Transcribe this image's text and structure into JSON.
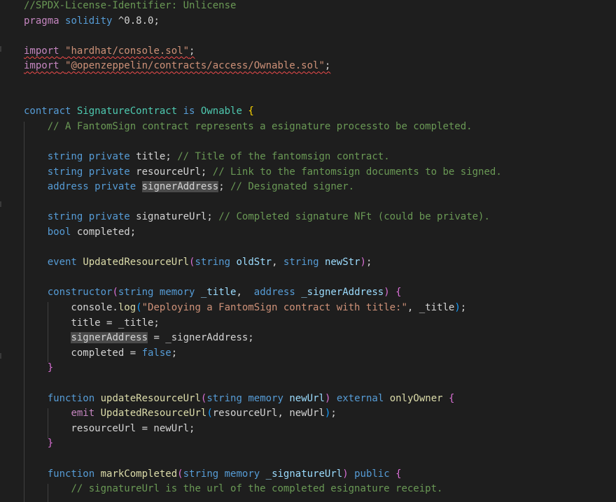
{
  "editor": {
    "lines": [
      [
        {
          "t": "//SPDX-License-Identifier: Unlicense",
          "c": "#6a9955"
        }
      ],
      [
        {
          "t": "pragma",
          "c": "#c586c0"
        },
        {
          "t": " "
        },
        {
          "t": "solidity",
          "c": "#569cd6"
        },
        {
          "t": " ^0.8.0;"
        }
      ],
      [],
      [
        {
          "t": "import",
          "c": "#c586c0",
          "u": true
        },
        {
          "t": " ",
          "u": true
        },
        {
          "t": "\"hardhat/console.sol\"",
          "c": "#ce9178",
          "u": true
        },
        {
          "t": ";",
          "u": true
        }
      ],
      [
        {
          "t": "import",
          "c": "#c586c0",
          "u": true
        },
        {
          "t": " ",
          "u": true
        },
        {
          "t": "\"@openzeppelin/contracts/access/Ownable.sol\"",
          "c": "#ce9178",
          "u": true
        },
        {
          "t": ";",
          "u": true
        }
      ],
      [],
      [],
      [
        {
          "t": "contract",
          "c": "#569cd6"
        },
        {
          "t": " "
        },
        {
          "t": "SignatureContract",
          "c": "#4ec9b0"
        },
        {
          "t": " "
        },
        {
          "t": "is",
          "c": "#569cd6"
        },
        {
          "t": " "
        },
        {
          "t": "Ownable",
          "c": "#4ec9b0"
        },
        {
          "t": " "
        },
        {
          "t": "{",
          "c": "#ffd700"
        }
      ],
      [
        {
          "t": "    "
        },
        {
          "t": "// A FantomSign contract represents a esignature processto be completed.",
          "c": "#6a9955"
        }
      ],
      [],
      [
        {
          "t": "    "
        },
        {
          "t": "string",
          "c": "#569cd6"
        },
        {
          "t": " "
        },
        {
          "t": "private",
          "c": "#569cd6"
        },
        {
          "t": " title; "
        },
        {
          "t": "// Title of the fantomsign contract.",
          "c": "#6a9955"
        }
      ],
      [
        {
          "t": "    "
        },
        {
          "t": "string",
          "c": "#569cd6"
        },
        {
          "t": " "
        },
        {
          "t": "private",
          "c": "#569cd6"
        },
        {
          "t": " resourceUrl; "
        },
        {
          "t": "// Link to the fantomsign documents to be signed.",
          "c": "#6a9955"
        }
      ],
      [
        {
          "t": "    "
        },
        {
          "t": "address",
          "c": "#569cd6"
        },
        {
          "t": " "
        },
        {
          "t": "private",
          "c": "#569cd6"
        },
        {
          "t": " "
        },
        {
          "t": "signerAddress",
          "h": true
        },
        {
          "t": "; "
        },
        {
          "t": "// Designated signer.",
          "c": "#6a9955"
        }
      ],
      [],
      [
        {
          "t": "    "
        },
        {
          "t": "string",
          "c": "#569cd6"
        },
        {
          "t": " "
        },
        {
          "t": "private",
          "c": "#569cd6"
        },
        {
          "t": " signatureUrl; "
        },
        {
          "t": "// Completed signature NFt (could be private).",
          "c": "#6a9955"
        }
      ],
      [
        {
          "t": "    "
        },
        {
          "t": "bool",
          "c": "#569cd6"
        },
        {
          "t": " completed;"
        }
      ],
      [],
      [
        {
          "t": "    "
        },
        {
          "t": "event",
          "c": "#569cd6"
        },
        {
          "t": " "
        },
        {
          "t": "UpdatedResourceUrl",
          "c": "#dcdcaa"
        },
        {
          "t": "(",
          "c": "#da70d6"
        },
        {
          "t": "string",
          "c": "#569cd6"
        },
        {
          "t": " "
        },
        {
          "t": "oldStr",
          "c": "#9cdcfe"
        },
        {
          "t": ", "
        },
        {
          "t": "string",
          "c": "#569cd6"
        },
        {
          "t": " "
        },
        {
          "t": "newStr",
          "c": "#9cdcfe"
        },
        {
          "t": ")",
          "c": "#da70d6"
        },
        {
          "t": ";"
        }
      ],
      [],
      [
        {
          "t": "    "
        },
        {
          "t": "constructor",
          "c": "#569cd6"
        },
        {
          "t": "(",
          "c": "#da70d6"
        },
        {
          "t": "string",
          "c": "#569cd6"
        },
        {
          "t": " "
        },
        {
          "t": "memory",
          "c": "#569cd6"
        },
        {
          "t": " "
        },
        {
          "t": "_title",
          "c": "#9cdcfe"
        },
        {
          "t": ",  "
        },
        {
          "t": "address",
          "c": "#569cd6"
        },
        {
          "t": " "
        },
        {
          "t": "_signerAddress",
          "c": "#9cdcfe"
        },
        {
          "t": ")",
          "c": "#da70d6"
        },
        {
          "t": " "
        },
        {
          "t": "{",
          "c": "#da70d6"
        }
      ],
      [
        {
          "t": "        console."
        },
        {
          "t": "log",
          "c": "#dcdcaa"
        },
        {
          "t": "(",
          "c": "#179fff"
        },
        {
          "t": "\"Deploying a FantomSign contract with title:\"",
          "c": "#ce9178"
        },
        {
          "t": ", _title"
        },
        {
          "t": ")",
          "c": "#179fff"
        },
        {
          "t": ";"
        }
      ],
      [
        {
          "t": "        title = _title;"
        }
      ],
      [
        {
          "t": "        "
        },
        {
          "t": "signerAddress",
          "h": true
        },
        {
          "t": " = _signerAddress;"
        }
      ],
      [
        {
          "t": "        completed = "
        },
        {
          "t": "false",
          "c": "#569cd6"
        },
        {
          "t": ";"
        }
      ],
      [
        {
          "t": "    "
        },
        {
          "t": "}",
          "c": "#da70d6"
        }
      ],
      [],
      [
        {
          "t": "    "
        },
        {
          "t": "function",
          "c": "#569cd6"
        },
        {
          "t": " "
        },
        {
          "t": "updateResourceUrl",
          "c": "#dcdcaa"
        },
        {
          "t": "(",
          "c": "#da70d6"
        },
        {
          "t": "string",
          "c": "#569cd6"
        },
        {
          "t": " "
        },
        {
          "t": "memory",
          "c": "#569cd6"
        },
        {
          "t": " "
        },
        {
          "t": "newUrl",
          "c": "#9cdcfe"
        },
        {
          "t": ")",
          "c": "#da70d6"
        },
        {
          "t": " "
        },
        {
          "t": "external",
          "c": "#569cd6"
        },
        {
          "t": " "
        },
        {
          "t": "onlyOwner",
          "c": "#dcdcaa"
        },
        {
          "t": " "
        },
        {
          "t": "{",
          "c": "#da70d6"
        }
      ],
      [
        {
          "t": "        "
        },
        {
          "t": "emit",
          "c": "#c586c0"
        },
        {
          "t": " "
        },
        {
          "t": "UpdatedResourceUrl",
          "c": "#dcdcaa"
        },
        {
          "t": "(",
          "c": "#179fff"
        },
        {
          "t": "resourceUrl, newUrl"
        },
        {
          "t": ")",
          "c": "#179fff"
        },
        {
          "t": ";"
        }
      ],
      [
        {
          "t": "        resourceUrl = newUrl;"
        }
      ],
      [
        {
          "t": "    "
        },
        {
          "t": "}",
          "c": "#da70d6"
        }
      ],
      [],
      [
        {
          "t": "    "
        },
        {
          "t": "function",
          "c": "#569cd6"
        },
        {
          "t": " "
        },
        {
          "t": "markCompleted",
          "c": "#dcdcaa"
        },
        {
          "t": "(",
          "c": "#da70d6"
        },
        {
          "t": "string",
          "c": "#569cd6"
        },
        {
          "t": " "
        },
        {
          "t": "memory",
          "c": "#569cd6"
        },
        {
          "t": " "
        },
        {
          "t": "_signatureUrl",
          "c": "#9cdcfe"
        },
        {
          "t": ")",
          "c": "#da70d6"
        },
        {
          "t": " "
        },
        {
          "t": "public",
          "c": "#569cd6"
        },
        {
          "t": " "
        },
        {
          "t": "{",
          "c": "#da70d6"
        }
      ],
      [
        {
          "t": "        "
        },
        {
          "t": "// signatureUrl is the url of the completed esignature receipt.",
          "c": "#6a9955"
        }
      ]
    ]
  }
}
